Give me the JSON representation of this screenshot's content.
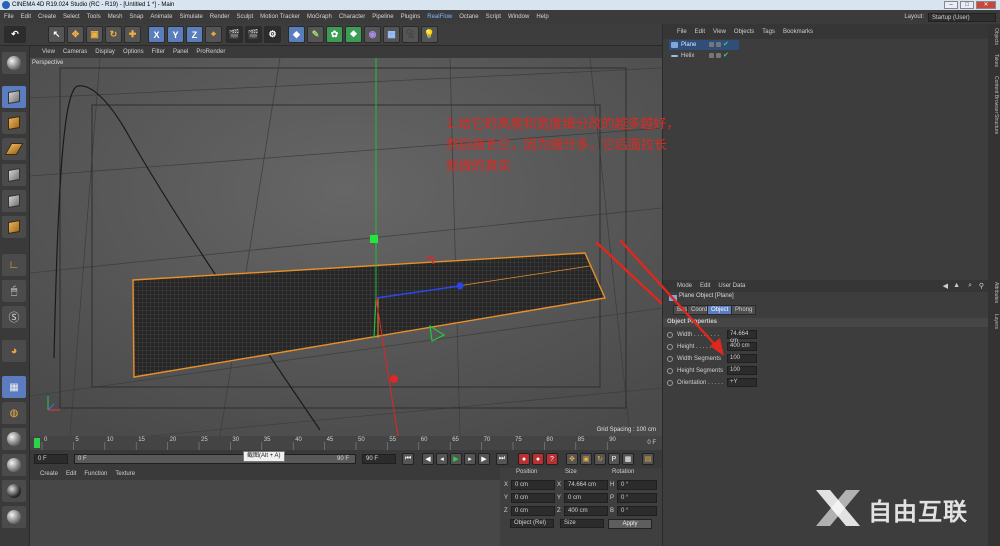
{
  "window": {
    "title": "CINEMA 4D R19.024 Studio (RC - R19) - [Untitled 1 *] - Main"
  },
  "menubar": [
    "File",
    "Edit",
    "Create",
    "Select",
    "Tools",
    "Mesh",
    "Snap",
    "Animate",
    "Simulate",
    "Render",
    "Sculpt",
    "Motion Tracker",
    "MoGraph",
    "Character",
    "Pipeline",
    "Plugins",
    "RealFlow",
    "Octane",
    "Script",
    "Window",
    "Help"
  ],
  "layout": {
    "label": "Layout:",
    "value": "Startup (User)"
  },
  "toolbar": {
    "axis_x": "X",
    "axis_y": "Y",
    "axis_z": "Z"
  },
  "viewport": {
    "menu": [
      "View",
      "Cameras",
      "Display",
      "Options",
      "Filter",
      "Panel",
      "ProRender"
    ],
    "label": "Perspective",
    "grid_spacing": "Grid Spacing : 100 cm"
  },
  "annotation": {
    "line1": "1.给它的高度和宽度细分改的越多越好，",
    "line2": "然后拖长它，因为细分多，它后面拉长",
    "line3": "就做的真实",
    "color": "#e0271e"
  },
  "timeline": {
    "ticks": [
      "0",
      "5",
      "10",
      "15",
      "20",
      "25",
      "30",
      "35",
      "40",
      "45",
      "50",
      "55",
      "60",
      "65",
      "70",
      "75",
      "80",
      "85",
      "90"
    ],
    "end_marker": "0 F",
    "start_field": "0 F",
    "slider_start": "0 F",
    "slider_end": "90 F",
    "end_field": "90 F",
    "tooltip": "截图(Alt + A)"
  },
  "material_manager": {
    "menu": [
      "Create",
      "Edit",
      "Function",
      "Texture"
    ]
  },
  "coordinates": {
    "headers": {
      "position": "Position",
      "size": "Size",
      "rotation": "Rotation"
    },
    "rows": [
      {
        "axis": "X",
        "pos": "0 cm",
        "size_axis": "X",
        "size": "74.664 cm",
        "rot_axis": "H",
        "rot": "0 °"
      },
      {
        "axis": "Y",
        "pos": "0 cm",
        "size_axis": "Y",
        "size": "0 cm",
        "rot_axis": "P",
        "rot": "0 °"
      },
      {
        "axis": "Z",
        "pos": "0 cm",
        "size_axis": "Z",
        "size": "400 cm",
        "rot_axis": "B",
        "rot": "0 °"
      }
    ],
    "mode": "Object (Rel)",
    "size_mode": "Size",
    "apply": "Apply"
  },
  "object_manager": {
    "menu": [
      "File",
      "Edit",
      "View",
      "Objects",
      "Tags",
      "Bookmarks"
    ],
    "objects": [
      {
        "name": "Plane",
        "selected": true
      },
      {
        "name": "Helix",
        "selected": false
      }
    ]
  },
  "attributes": {
    "menu": [
      "Mode",
      "Edit",
      "User Data"
    ],
    "title": "Plane Object [Plane]",
    "tabs": [
      "Basic",
      "Coord.",
      "Object",
      "Phong"
    ],
    "active_tab": "Object",
    "section": "Object Properties",
    "props": [
      {
        "label": "Width . . . . . . . .",
        "value": "74.664 cm"
      },
      {
        "label": "Height . . . . . . . .",
        "value": "400 cm"
      },
      {
        "label": "Width Segments",
        "value": "100"
      },
      {
        "label": "Height Segments",
        "value": "100"
      },
      {
        "label": "Orientation . . . . .",
        "value": "+Y"
      }
    ]
  },
  "right_tabs": [
    "Objects",
    "Takes",
    "Content Browser",
    "Structure",
    "Attributes",
    "Layers"
  ],
  "watermark": {
    "text": "自由互联"
  },
  "colors": {
    "accent_blue": "#5c7cc0",
    "object_outline": "#e8902a",
    "annotation_red": "#e0271e",
    "axis_green": "#21c43a",
    "axis_red": "#e02626",
    "axis_blue": "#2b45e8"
  }
}
